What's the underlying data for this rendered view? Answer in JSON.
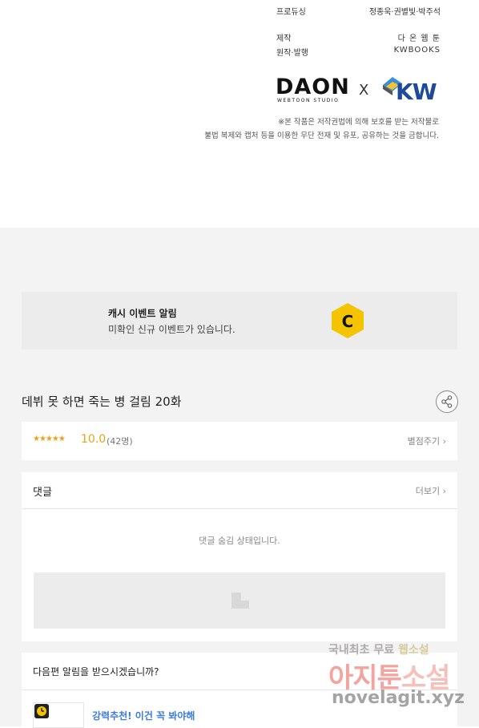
{
  "credits": {
    "rows": [
      {
        "label": "프로듀싱",
        "value": "정종욱·권별빛·박주석"
      },
      {
        "label": "제작",
        "value": "다 온 웹 툰"
      },
      {
        "label": "원작·발행",
        "value": "KWBOOKS"
      }
    ],
    "logo_daon": "DAON",
    "logo_daon_sub": "WEBTOON STUDIO",
    "logo_separator": "X",
    "logo_kw": "KW",
    "notice_line1": "※본 작품은 저작권법에 의해 보호를 받는 저작물로",
    "notice_line2": "불법 복제와 캡처 등을 이용한 무단 전재 및 유포, 공유하는 것을 금합니다."
  },
  "banner": {
    "title": "캐시 이벤트 알림",
    "subtitle": "미확인 신규 이벤트가 있습니다.",
    "icon": "cash-coin-icon",
    "icon_letter": "C",
    "icon_color": "#f5c400"
  },
  "episode": {
    "title": "데뷔 못 하면 죽는 병 걸림 20화",
    "share_icon": "share-icon"
  },
  "rating": {
    "stars": "★★★★★",
    "score": "10.0",
    "count": "(42명)",
    "rate_link": "별점주기",
    "rate_value": 10.0,
    "rate_max": 10,
    "star_color": "#e8a317"
  },
  "comments": {
    "title": "댓글",
    "more_link": "더보기",
    "hidden_message": "댓글 숨김 상태입니다."
  },
  "next_episode": {
    "question": "다음편 알림을 받으시겠습니까?",
    "recommend_text": "강력추천! 이건 꼭 봐야해",
    "recommend_color": "#3b7be0"
  },
  "watermark": {
    "line1_a": "국내최초 무료",
    "line1_b": "웹소설",
    "line2_a": "아지툰",
    "line2_b": "소설",
    "line3": "novelagit.xyz"
  }
}
